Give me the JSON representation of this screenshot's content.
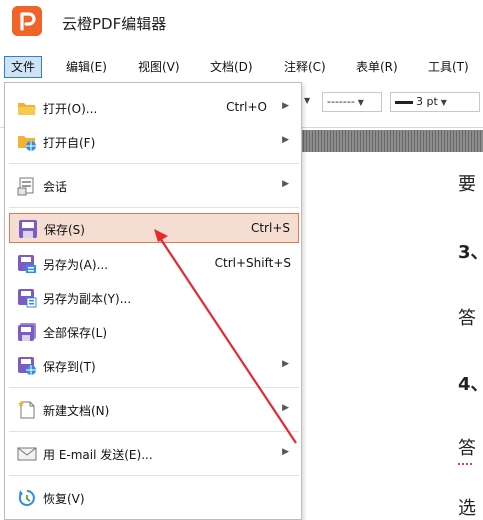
{
  "app": {
    "title": "云橙PDF编辑器"
  },
  "menubar": {
    "items": [
      {
        "label": "文件"
      },
      {
        "label": "编辑(E)"
      },
      {
        "label": "视图(V)"
      },
      {
        "label": "文档(D)"
      },
      {
        "label": "注释(C)"
      },
      {
        "label": "表单(R)"
      },
      {
        "label": "工具(T)"
      }
    ]
  },
  "toolbar": {
    "dash_style": "-------",
    "line_width": "3 pt"
  },
  "file_menu": {
    "items": [
      {
        "label": "打开(O)...",
        "shortcut": "Ctrl+O",
        "has_submenu": true,
        "icon": "open-folder-icon"
      },
      {
        "label": "打开自(F)",
        "shortcut": "",
        "has_submenu": true,
        "icon": "open-from-icon"
      },
      {
        "label": "会话",
        "shortcut": "",
        "has_submenu": true,
        "icon": "session-icon"
      },
      {
        "label": "保存(S)",
        "shortcut": "Ctrl+S",
        "has_submenu": false,
        "icon": "save-icon",
        "highlighted": true
      },
      {
        "label": "另存为(A)...",
        "shortcut": "Ctrl+Shift+S",
        "has_submenu": false,
        "icon": "save-as-icon"
      },
      {
        "label": "另存为副本(Y)...",
        "shortcut": "",
        "has_submenu": false,
        "icon": "save-copy-icon"
      },
      {
        "label": "全部保存(L)",
        "shortcut": "",
        "has_submenu": false,
        "icon": "save-all-icon"
      },
      {
        "label": "保存到(T)",
        "shortcut": "",
        "has_submenu": true,
        "icon": "save-to-icon"
      },
      {
        "label": "新建文档(N)",
        "shortcut": "",
        "has_submenu": true,
        "icon": "new-document-icon"
      },
      {
        "label": "用 E-mail 发送(E)...",
        "shortcut": "",
        "has_submenu": true,
        "icon": "email-icon"
      },
      {
        "label": "恢复(V)",
        "shortcut": "",
        "has_submenu": false,
        "icon": "restore-icon"
      }
    ]
  },
  "document": {
    "lines": [
      "要",
      "3、",
      "答",
      "4、",
      "答",
      "选"
    ]
  },
  "colors": {
    "accent": "#f0642a",
    "highlight_bg": "#f5ddd1",
    "highlight_border": "#e07a52",
    "annotation_arrow": "#e8282a",
    "menubar_active": "#cfe3f7"
  }
}
